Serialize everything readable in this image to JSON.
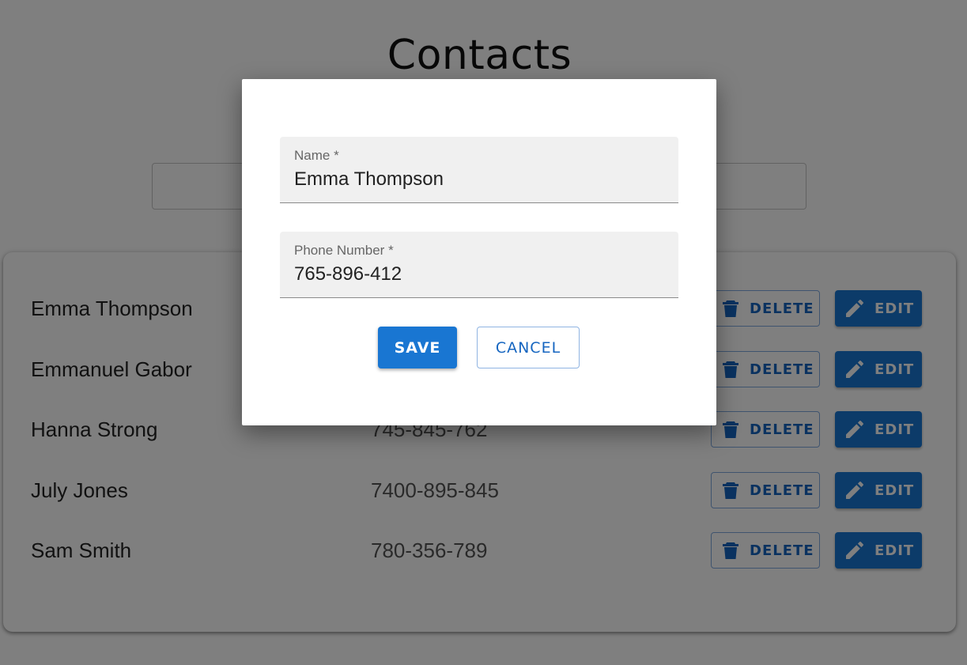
{
  "page": {
    "title": "Contacts"
  },
  "search": {
    "value": ""
  },
  "contacts": [
    {
      "name": "Emma Thompson",
      "phone": "765-896-412"
    },
    {
      "name": "Emmanuel Gabor",
      "phone": ""
    },
    {
      "name": "Hanna Strong",
      "phone": "745-845-762"
    },
    {
      "name": "July Jones",
      "phone": "7400-895-845"
    },
    {
      "name": "Sam Smith",
      "phone": "780-356-789"
    }
  ],
  "row_actions": {
    "delete_label": "DELETE",
    "edit_label": "EDIT"
  },
  "dialog": {
    "name_label": "Name *",
    "name_value": "Emma Thompson",
    "phone_label": "Phone Number *",
    "phone_value": "765-896-412",
    "save_label": "SAVE",
    "cancel_label": "CANCEL"
  },
  "colors": {
    "primary": "#1976d2",
    "overlay": "rgba(0,0,0,0.5)"
  },
  "icons": {
    "delete": "trash-icon",
    "edit": "pencil-icon"
  }
}
